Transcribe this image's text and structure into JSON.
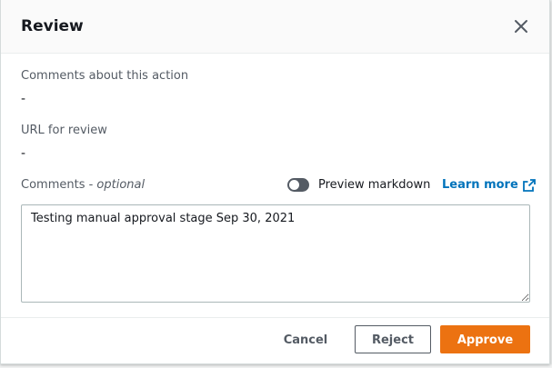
{
  "modal": {
    "title": "Review",
    "close_label": "close-icon"
  },
  "fields": {
    "comments_about_action": {
      "label": "Comments about this action",
      "value": "-"
    },
    "url_for_review": {
      "label": "URL for review",
      "value": "-"
    },
    "comments": {
      "label": "Comments - ",
      "label_optional": "optional",
      "value": "Testing manual approval stage Sep 30, 2021"
    }
  },
  "preview": {
    "toggle_label": "Preview markdown",
    "enabled": false
  },
  "learn_more": {
    "label": "Learn more",
    "icon": "external-link-icon"
  },
  "footer": {
    "cancel_label": "Cancel",
    "reject_label": "Reject",
    "approve_label": "Approve"
  },
  "colors": {
    "accent": "#ec7211",
    "link": "#0073bb",
    "text": "#16191f",
    "muted": "#545b64"
  }
}
